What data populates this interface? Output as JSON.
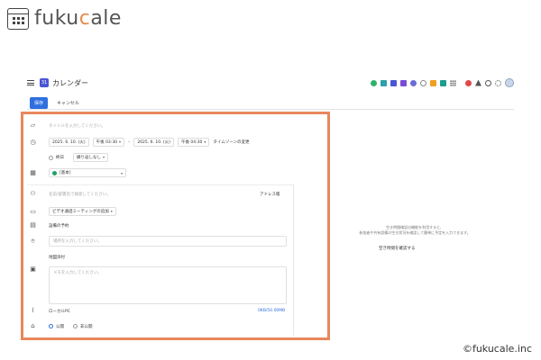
{
  "brand": {
    "name_pre": "fuku",
    "name_c": "c",
    "name_post": "ale"
  },
  "app": {
    "title": "カレンダー"
  },
  "toolbar": {
    "save": "保存",
    "cancel": "キャンセル"
  },
  "form": {
    "title_placeholder": "タイトルを入力してください。",
    "start_date": "2025. 6. 10. (火)",
    "start_time": "午後 03:30",
    "dash": "–",
    "end_date": "2025. 6. 10. (火)",
    "end_time": "午後 04:30",
    "timezone_link": "タイムゾーンの変更",
    "all_day": "終日",
    "repeat": "繰り返しなし",
    "calendar_name": "[基本]",
    "attendee_placeholder": "名前/部署名で検索してください。",
    "address_book": "アドレス帳",
    "video_meeting": "ビデオ通話ミーティングの追加",
    "facility": "設備の予約",
    "location_placeholder": "場所を入力してください。",
    "map_attach": "地図添付",
    "memo_placeholder": "メモを入力してください。",
    "attachment_local": "ローカルPC",
    "attachment_size": "0KB/50.00MB",
    "visibility_public": "公開",
    "visibility_private": "非公開"
  },
  "right_panel": {
    "line1": "空き時間確認の機能を利用すると、",
    "line2": "参加者や共有設備の空き状況を確認して簡単に予定を入力できます。",
    "button": "空き時間を確認する"
  },
  "copyright": "©fukucale.inc",
  "colors": {
    "accent": "#2f6fe0",
    "highlight": "#e8875c",
    "calendar_green": "#1ea362"
  }
}
